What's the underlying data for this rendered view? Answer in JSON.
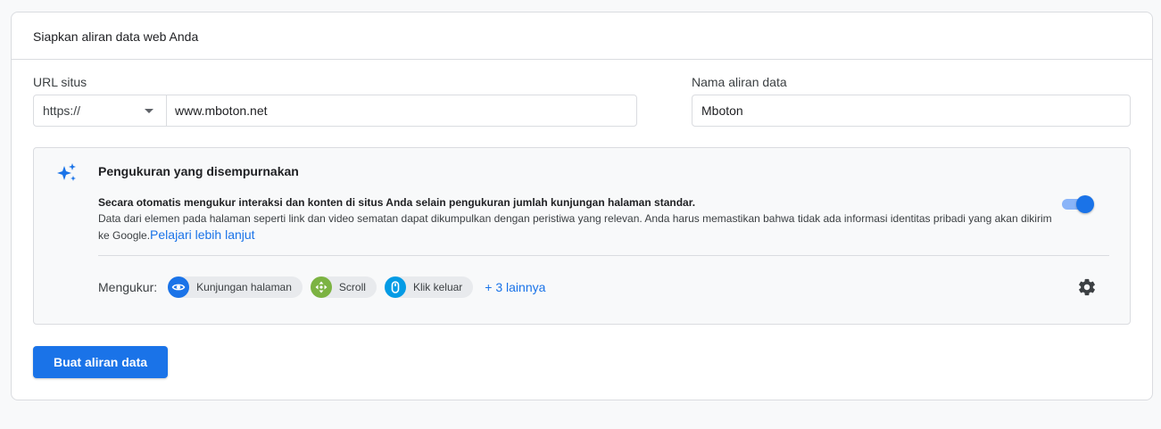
{
  "card": {
    "title": "Siapkan aliran data web Anda"
  },
  "url_field": {
    "label": "URL situs",
    "protocol": "https://",
    "value": "www.mboton.net"
  },
  "name_field": {
    "label": "Nama aliran data",
    "value": "Mboton"
  },
  "enhanced_measurement": {
    "title": "Pengukuran yang disempurnakan",
    "desc_bold": "Secara otomatis mengukur interaksi dan konten di situs Anda selain pengukuran jumlah kunjungan halaman standar.",
    "desc_text": "Data dari elemen pada halaman seperti link dan video sematan dapat dikumpulkan dengan peristiwa yang relevan. Anda harus memastikan bahwa tidak ada informasi identitas pribadi yang akan dikirim ke Google.",
    "learn_more": "Pelajari lebih lanjut",
    "toggle_on": true,
    "measure_label": "Mengukur:",
    "chips": [
      {
        "label": "Kunjungan halaman",
        "icon": "eye-icon",
        "color": "#1a73e8"
      },
      {
        "label": "Scroll",
        "icon": "scroll-icon",
        "color": "#7cb342"
      },
      {
        "label": "Klik keluar",
        "icon": "mouse-icon",
        "color": "#039be5"
      }
    ],
    "more": "+ 3 lainnya"
  },
  "create_button": "Buat aliran data"
}
